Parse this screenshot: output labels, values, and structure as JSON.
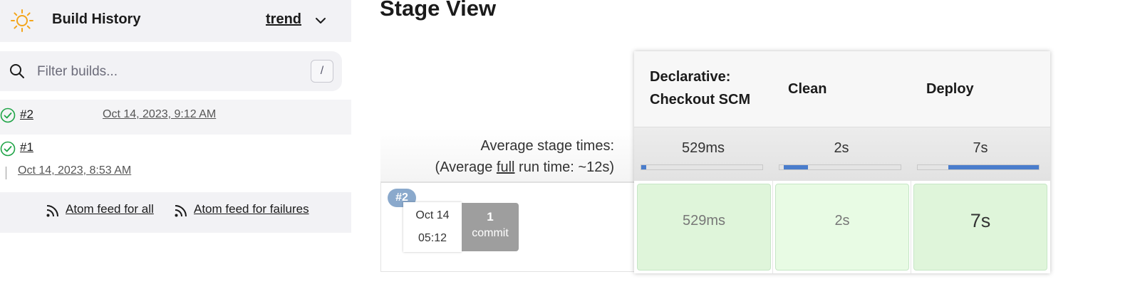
{
  "build_history": {
    "title": "Build History",
    "trend_label": "trend",
    "search": {
      "placeholder": "Filter builds...",
      "value": "",
      "shortcut": "/"
    },
    "builds": [
      {
        "number": "#2",
        "date": "Oct 14, 2023, 9:12 AM",
        "status": "success"
      },
      {
        "number": "#1",
        "date": "Oct 14, 2023, 8:53 AM",
        "status": "success"
      }
    ],
    "feeds": {
      "all": "Atom feed for all",
      "failures": "Atom feed for failures"
    }
  },
  "stage_view": {
    "title": "Stage View",
    "avg_label_1": "Average stage times:",
    "avg_label_2_prefix": "(Average ",
    "avg_label_2_link": "full",
    "avg_label_2_suffix": " run time: ~12s)",
    "stages": [
      {
        "name_line1": "Declarative:",
        "name_line2": "Checkout SCM",
        "avg": "529ms",
        "avg_fraction": 0.04,
        "run_time": "529ms"
      },
      {
        "name_line1": "Clean",
        "name_line2": "",
        "avg": "2s",
        "avg_fraction": 0.2,
        "run_time": "2s"
      },
      {
        "name_line1": "Deploy",
        "name_line2": "",
        "avg": "7s",
        "avg_fraction": 0.75,
        "run_time": "7s"
      }
    ],
    "run": {
      "badge": "#2",
      "date": "Oct 14",
      "time": "05:12",
      "commit_count": "1",
      "commit_word": "commit"
    }
  },
  "colors": {
    "success_green": "#1ea446",
    "progress_blue": "#4a7dcc",
    "cell_green_light": "#e6f7e1",
    "sun_orange": "#f3a51b"
  }
}
